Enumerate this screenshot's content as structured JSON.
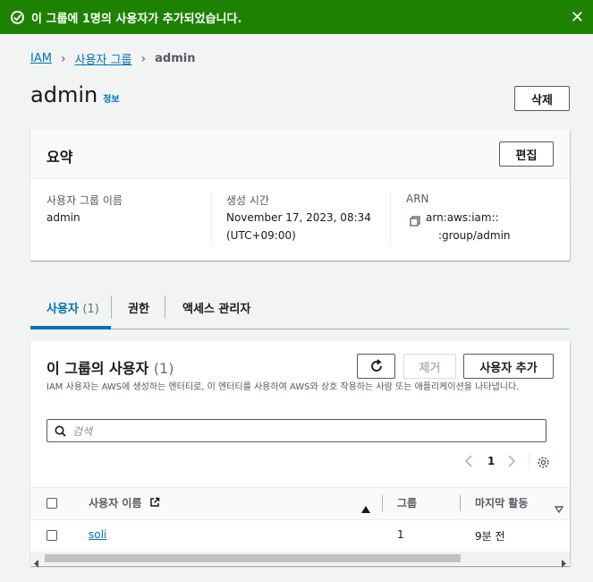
{
  "flash": {
    "message": "이 그룹에 1명의 사용자가 추가되었습니다.",
    "close_glyph": "✕"
  },
  "breadcrumb": {
    "items": [
      "IAM",
      "사용자 그룹",
      "admin"
    ],
    "separator": "›"
  },
  "page": {
    "title": "admin",
    "info_link": "정보",
    "delete_label": "삭제"
  },
  "summary": {
    "title": "요약",
    "edit_label": "편집",
    "fields": [
      {
        "label": "사용자 그룹 이름",
        "value": "admin"
      },
      {
        "label": "생성 시간",
        "value_line1": "November 17, 2023, 08:34",
        "value_line2": "(UTC+09:00)"
      },
      {
        "label": "ARN",
        "value_line1": "arn:aws:iam::",
        "value_line2": ":group/admin"
      }
    ]
  },
  "tabs": [
    {
      "label": "사용자",
      "count": "(1)",
      "active": true
    },
    {
      "label": "권한",
      "active": false
    },
    {
      "label": "액세스 관리자",
      "active": false
    }
  ],
  "users_panel": {
    "title": "이 그룹의 사용자",
    "count": "(1)",
    "description": "IAM 사용자는 AWS에 생성하는 엔터티로, 이 엔터티를 사용하여 AWS와 상호 작용하는 사람 또는 애플리케이션을 나타냅니다.",
    "remove_label": "제거",
    "add_label": "사용자 추가",
    "search_placeholder": "검색",
    "page_number": "1",
    "columns": [
      "사용자 이름",
      "그룹",
      "마지막 활동"
    ],
    "rows": [
      {
        "user_name": "soli",
        "groups": "1",
        "last_activity": "9분 전"
      }
    ]
  },
  "colors": {
    "success": "#1d8102",
    "link": "#0073bb",
    "text": "#16191f"
  }
}
